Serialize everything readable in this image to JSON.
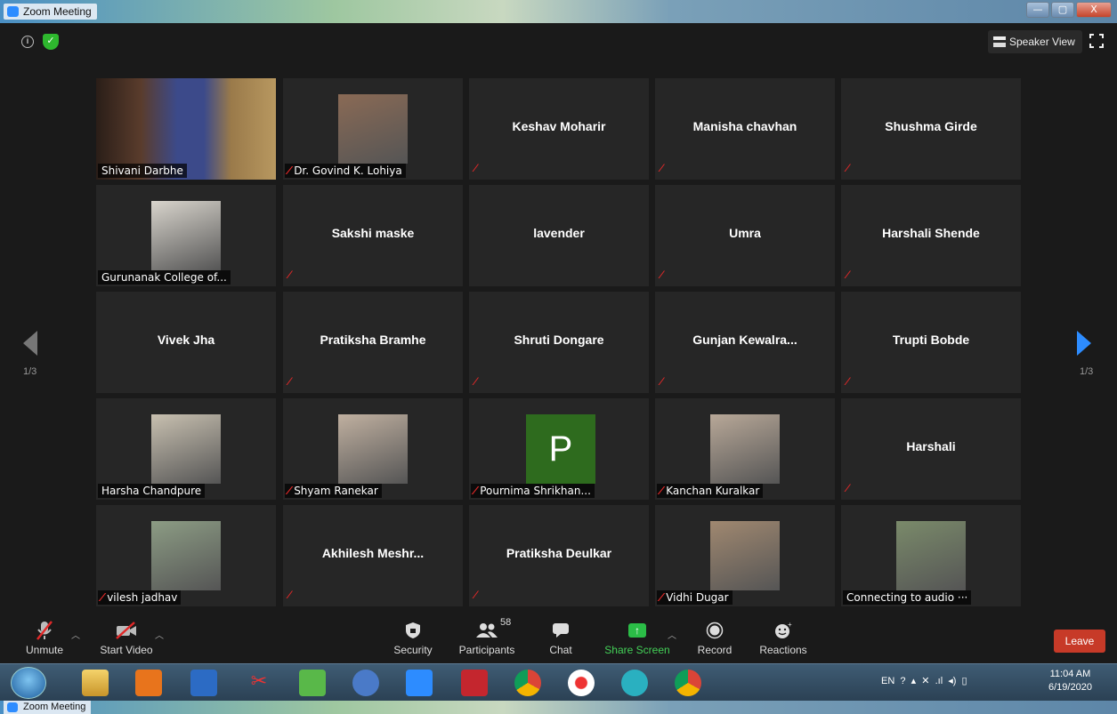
{
  "window": {
    "title": "Zoom Meeting",
    "controls": [
      "—",
      "▢",
      "X"
    ]
  },
  "top_bar": {
    "speaker_view_label": "Speaker View"
  },
  "pagination": {
    "left": "1/3",
    "right": "1/3"
  },
  "participants": [
    {
      "name": "Shivani Darbhe",
      "video": true,
      "muted": false,
      "active": true
    },
    {
      "name": "Dr. Govind K. Lohiya",
      "video": true,
      "muted": true
    },
    {
      "name": "Keshav Moharir",
      "video": false,
      "muted": true
    },
    {
      "name": "Manisha chavhan",
      "video": false,
      "muted": true
    },
    {
      "name": "Shushma Girde",
      "video": false,
      "muted": true
    },
    {
      "name": "Gurunanak College of...",
      "video": true,
      "muted": false
    },
    {
      "name": "Sakshi maske",
      "video": false,
      "muted": true
    },
    {
      "name": "lavender",
      "video": false,
      "muted": false
    },
    {
      "name": "Umra",
      "video": false,
      "muted": true
    },
    {
      "name": "Harshali Shende",
      "video": false,
      "muted": true
    },
    {
      "name": "Vivek Jha",
      "video": false,
      "muted": false
    },
    {
      "name": "Pratiksha Bramhe",
      "video": false,
      "muted": true
    },
    {
      "name": "Shruti Dongare",
      "video": false,
      "muted": true
    },
    {
      "name": "Gunjan  Kewalra...",
      "video": false,
      "muted": true
    },
    {
      "name": "Trupti Bobde",
      "video": false,
      "muted": true
    },
    {
      "name": "Harsha Chandpure",
      "video": true,
      "muted": false
    },
    {
      "name": "Shyam Ranekar",
      "video": true,
      "muted": true
    },
    {
      "name": "Pournima Shrikhan...",
      "video": false,
      "avatar_letter": "P",
      "muted": true
    },
    {
      "name": "Kanchan Kuralkar",
      "video": true,
      "muted": true
    },
    {
      "name": "Harshali",
      "video": false,
      "muted": true
    },
    {
      "name": "vilesh jadhav",
      "video": true,
      "muted": true
    },
    {
      "name": "Akhilesh  Meshr...",
      "video": false,
      "muted": true
    },
    {
      "name": "Pratiksha Deulkar",
      "video": false,
      "muted": true
    },
    {
      "name": "Vidhi Dugar",
      "video": true,
      "muted": true
    },
    {
      "name": "Connecting to audio ···",
      "video": true,
      "muted": false
    }
  ],
  "toolbar": {
    "unmute": "Unmute",
    "start_video": "Start Video",
    "security": "Security",
    "participants": "Participants",
    "participants_count": "58",
    "chat": "Chat",
    "share_screen": "Share Screen",
    "record": "Record",
    "reactions": "Reactions",
    "leave": "Leave"
  },
  "taskbar": {
    "lang": "EN",
    "time": "11:04 AM",
    "date": "6/19/2020"
  },
  "colors": {
    "active_speaker_border": "#e6eb7a",
    "leave_button": "#c73a28",
    "share_screen": "#2bbd47",
    "muted_mic": "#e02828"
  }
}
